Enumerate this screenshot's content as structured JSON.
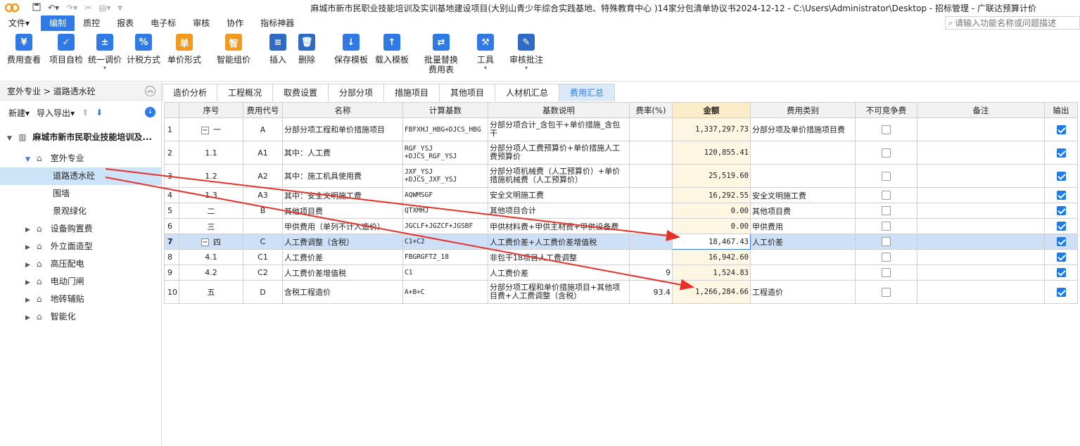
{
  "app": {
    "title": "麻城市新市民职业技能培训及实训基地建设项目(大别山青少年综合实践基地、特殊教育中心 )14家分包清单协议书2024-12-12 - C:\\Users\\Administrator\\Desktop - 招标管理 - 广联达预算计价"
  },
  "menus": [
    "文件",
    "编制",
    "质控",
    "报表",
    "电子标",
    "审核",
    "协作",
    "指标神器"
  ],
  "search": {
    "placeholder": "请输入功能名称或问题描述"
  },
  "toolbar": [
    {
      "label": "费用查看",
      "icon": "cost-view-icon"
    },
    {
      "label": "项目自检",
      "icon": "self-check-icon"
    },
    {
      "label": "统一调价",
      "icon": "price-adjust-icon"
    },
    {
      "label": "计税方式",
      "icon": "tax-method-icon"
    },
    {
      "label": "单价形式",
      "icon": "unit-price-icon"
    },
    {
      "label": "智能组价",
      "icon": "smart-pricing-icon"
    },
    {
      "label": "插入",
      "icon": "insert-icon"
    },
    {
      "label": "删除",
      "icon": "delete-icon"
    },
    {
      "label": "保存模板",
      "icon": "save-template-icon"
    },
    {
      "label": "载入模板",
      "icon": "load-template-icon"
    },
    {
      "label": "批量替换\n费用表",
      "icon": "batch-replace-icon"
    },
    {
      "label": "工具",
      "icon": "tools-icon"
    },
    {
      "label": "审核批注",
      "icon": "review-note-icon"
    }
  ],
  "left": {
    "breadcrumb": "室外专业 > 道路透水砼",
    "new_label": "新建",
    "io_label": "导入导出",
    "project": "麻城市新市民职业技能培训及...",
    "tree": [
      "室外专业",
      "道路透水砼",
      "围墙",
      "景观绿化",
      "设备购置费",
      "外立面造型",
      "高压配电",
      "电动门闸",
      "地砖辅贴",
      "智能化"
    ]
  },
  "tabs": [
    "造价分析",
    "工程概况",
    "取费设置",
    "分部分项",
    "措施项目",
    "其他项目",
    "人材机汇总",
    "费用汇总"
  ],
  "grid": {
    "headers": [
      "序号",
      "费用代号",
      "名称",
      "计算基数",
      "基数说明",
      "费率(%)",
      "金额",
      "费用类别",
      "不可竞争费",
      "备注",
      "输出"
    ],
    "rows": [
      {
        "n": "1",
        "seq": "一",
        "code": "A",
        "name": "分部分项工程和单价措施项目",
        "base": "FBFXHJ_HBG+DJCS_HBG",
        "desc": "分部分项合计_含包干+单价措施_含包干",
        "rate": "",
        "amount": "1,337,297.73",
        "cat": "分部分项及单价措施项目费"
      },
      {
        "n": "2",
        "seq": "1.1",
        "code": "A1",
        "name": "其中：人工费",
        "base": "RGF_YSJ +DJCS_RGF_YSJ",
        "desc": "分部分项人工费预算价+单价措施人工费预算价",
        "rate": "",
        "amount": "120,855.41",
        "cat": ""
      },
      {
        "n": "3",
        "seq": "1.2",
        "code": "A2",
        "name": "其中：施工机具使用费",
        "base": "JXF_YSJ +DJCS_JXF_YSJ",
        "desc": "分部分项机械费（人工预算价）+单价措施机械费（人工预算价）",
        "rate": "",
        "amount": "25,519.60",
        "cat": ""
      },
      {
        "n": "4",
        "seq": "1.3",
        "code": "A3",
        "name": "其中：安全文明施工费",
        "base": "AQWMSGF",
        "desc": "安全文明施工费",
        "rate": "",
        "amount": "16,292.55",
        "cat": "安全文明施工费"
      },
      {
        "n": "5",
        "seq": "二",
        "code": "B",
        "name": "其他项目费",
        "base": "QTXMHJ",
        "desc": "其他项目合计",
        "rate": "",
        "amount": "0.00",
        "cat": "其他项目费"
      },
      {
        "n": "6",
        "seq": "三",
        "code": "",
        "name": "甲供费用（单列不计入造价）",
        "base": "JGCLF+JGZCF+JGSBF",
        "desc": "甲供材料费+甲供主材费+甲供设备费",
        "rate": "",
        "amount": "0.00",
        "cat": "甲供费用"
      },
      {
        "n": "7",
        "seq": "四",
        "code": "C",
        "name": "人工费调整（含税）",
        "base": "C1+C2",
        "desc": "人工费价差+人工费价差增值税",
        "rate": "",
        "amount": "18,467.43",
        "cat": "人工价差"
      },
      {
        "n": "8",
        "seq": "4.1",
        "code": "C1",
        "name": "人工费价差",
        "base": "FBGRGFTZ_18",
        "desc": "非包干18项目人工费调整",
        "rate": "",
        "amount": "16,942.60",
        "cat": ""
      },
      {
        "n": "9",
        "seq": "4.2",
        "code": "C2",
        "name": "人工费价差增值税",
        "base": "C1",
        "desc": "人工费价差",
        "rate": "9",
        "amount": "1,524.83",
        "cat": ""
      },
      {
        "n": "10",
        "seq": "五",
        "code": "D",
        "name": "含税工程造价",
        "base": "A+B+C",
        "desc": "分部分项工程和单价措施项目+其他项目费+人工费调整（含税）",
        "rate": "93.4",
        "amount": "1,266,284.66",
        "cat": "工程造价"
      }
    ]
  },
  "colors": {
    "accent": "#2f7ae5",
    "annotation": "#e8302a"
  }
}
